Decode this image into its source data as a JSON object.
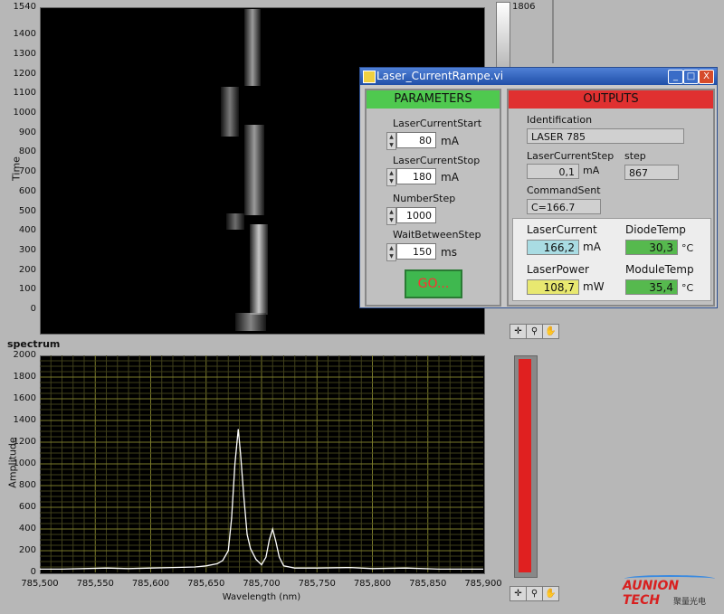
{
  "intensity_plot": {
    "y_title": "Time",
    "y_ticks": [
      "1540",
      "1400",
      "1300",
      "1200",
      "1100",
      "1000",
      "900",
      "800",
      "700",
      "600",
      "500",
      "400",
      "300",
      "200",
      "100",
      "0"
    ],
    "colorscale_max": "1806"
  },
  "spectrum": {
    "title": "spectrum",
    "y_title": "Amplitude",
    "x_title": "Wavelength (nm)",
    "y_ticks": [
      "2000",
      "1800",
      "1600",
      "1400",
      "1200",
      "1000",
      "800",
      "600",
      "400",
      "200",
      "0"
    ],
    "x_ticks": [
      "785,500",
      "785,550",
      "785,600",
      "785,650",
      "785,700",
      "785,750",
      "785,800",
      "785,850",
      "785,900"
    ]
  },
  "chart_data": {
    "type": "line",
    "title": "spectrum",
    "xlabel": "Wavelength (nm)",
    "ylabel": "Amplitude",
    "xlim": [
      785.5,
      785.9
    ],
    "ylim": [
      0,
      2000
    ],
    "grid": true,
    "series": [
      {
        "x": [
          785.5,
          785.52,
          785.54,
          785.56,
          785.58,
          785.6,
          785.62,
          785.64,
          785.65,
          785.66,
          785.665,
          785.67,
          785.673,
          785.676,
          785.679,
          785.681,
          785.684,
          785.687,
          785.69,
          785.695,
          785.7,
          785.704,
          785.707,
          785.71,
          785.713,
          785.716,
          785.72,
          785.73,
          785.75,
          785.78,
          785.8,
          785.83,
          785.86,
          785.9
        ],
        "y": [
          30,
          30,
          35,
          40,
          35,
          40,
          45,
          50,
          60,
          80,
          110,
          200,
          500,
          1000,
          1320,
          1100,
          700,
          350,
          220,
          120,
          70,
          140,
          300,
          400,
          280,
          140,
          60,
          40,
          40,
          45,
          35,
          40,
          30,
          30
        ]
      }
    ]
  },
  "window": {
    "title": "Laser_CurrentRampe.vi",
    "min_label": "_",
    "max_label": "□",
    "close_label": "X"
  },
  "parameters": {
    "header": "PARAMETERS",
    "start_label": "LaserCurrentStart",
    "start_value": "80",
    "start_unit": "mA",
    "stop_label": "LaserCurrentStop",
    "stop_value": "180",
    "stop_unit": "mA",
    "steps_label": "NumberStep",
    "steps_value": "1000",
    "wait_label": "WaitBetweenStep",
    "wait_value": "150",
    "wait_unit": "ms",
    "go_label": "GO..."
  },
  "outputs": {
    "header": "OUTPUTS",
    "id_label": "Identification",
    "id_value": "LASER 785",
    "step_label": "LaserCurrentStep",
    "step_value": "0,1",
    "step_unit": "mA",
    "stepcount_label": "step",
    "stepcount_value": "867",
    "cmd_label": "CommandSent",
    "cmd_value": "C=166.7",
    "current_label": "LaserCurrent",
    "current_value": "166,2",
    "current_unit": "mA",
    "diode_label": "DiodeTemp",
    "diode_value": "30,3",
    "diode_unit": "°C",
    "power_label": "LaserPower",
    "power_value": "108,7",
    "power_unit": "mW",
    "module_label": "ModuleTemp",
    "module_value": "35,4",
    "module_unit": "°C"
  },
  "colors": {
    "plot_bg": "#000000",
    "grid": "#6a6a2a",
    "trace": "#ffffff",
    "param_header": "#4fc94f",
    "output_header": "#e03030",
    "go_button": "#3fb84f",
    "go_text": "#ff3030",
    "meter_bar": "#e02020"
  },
  "logo": {
    "name": "AUNION TECH",
    "sub": "聚量光电"
  }
}
